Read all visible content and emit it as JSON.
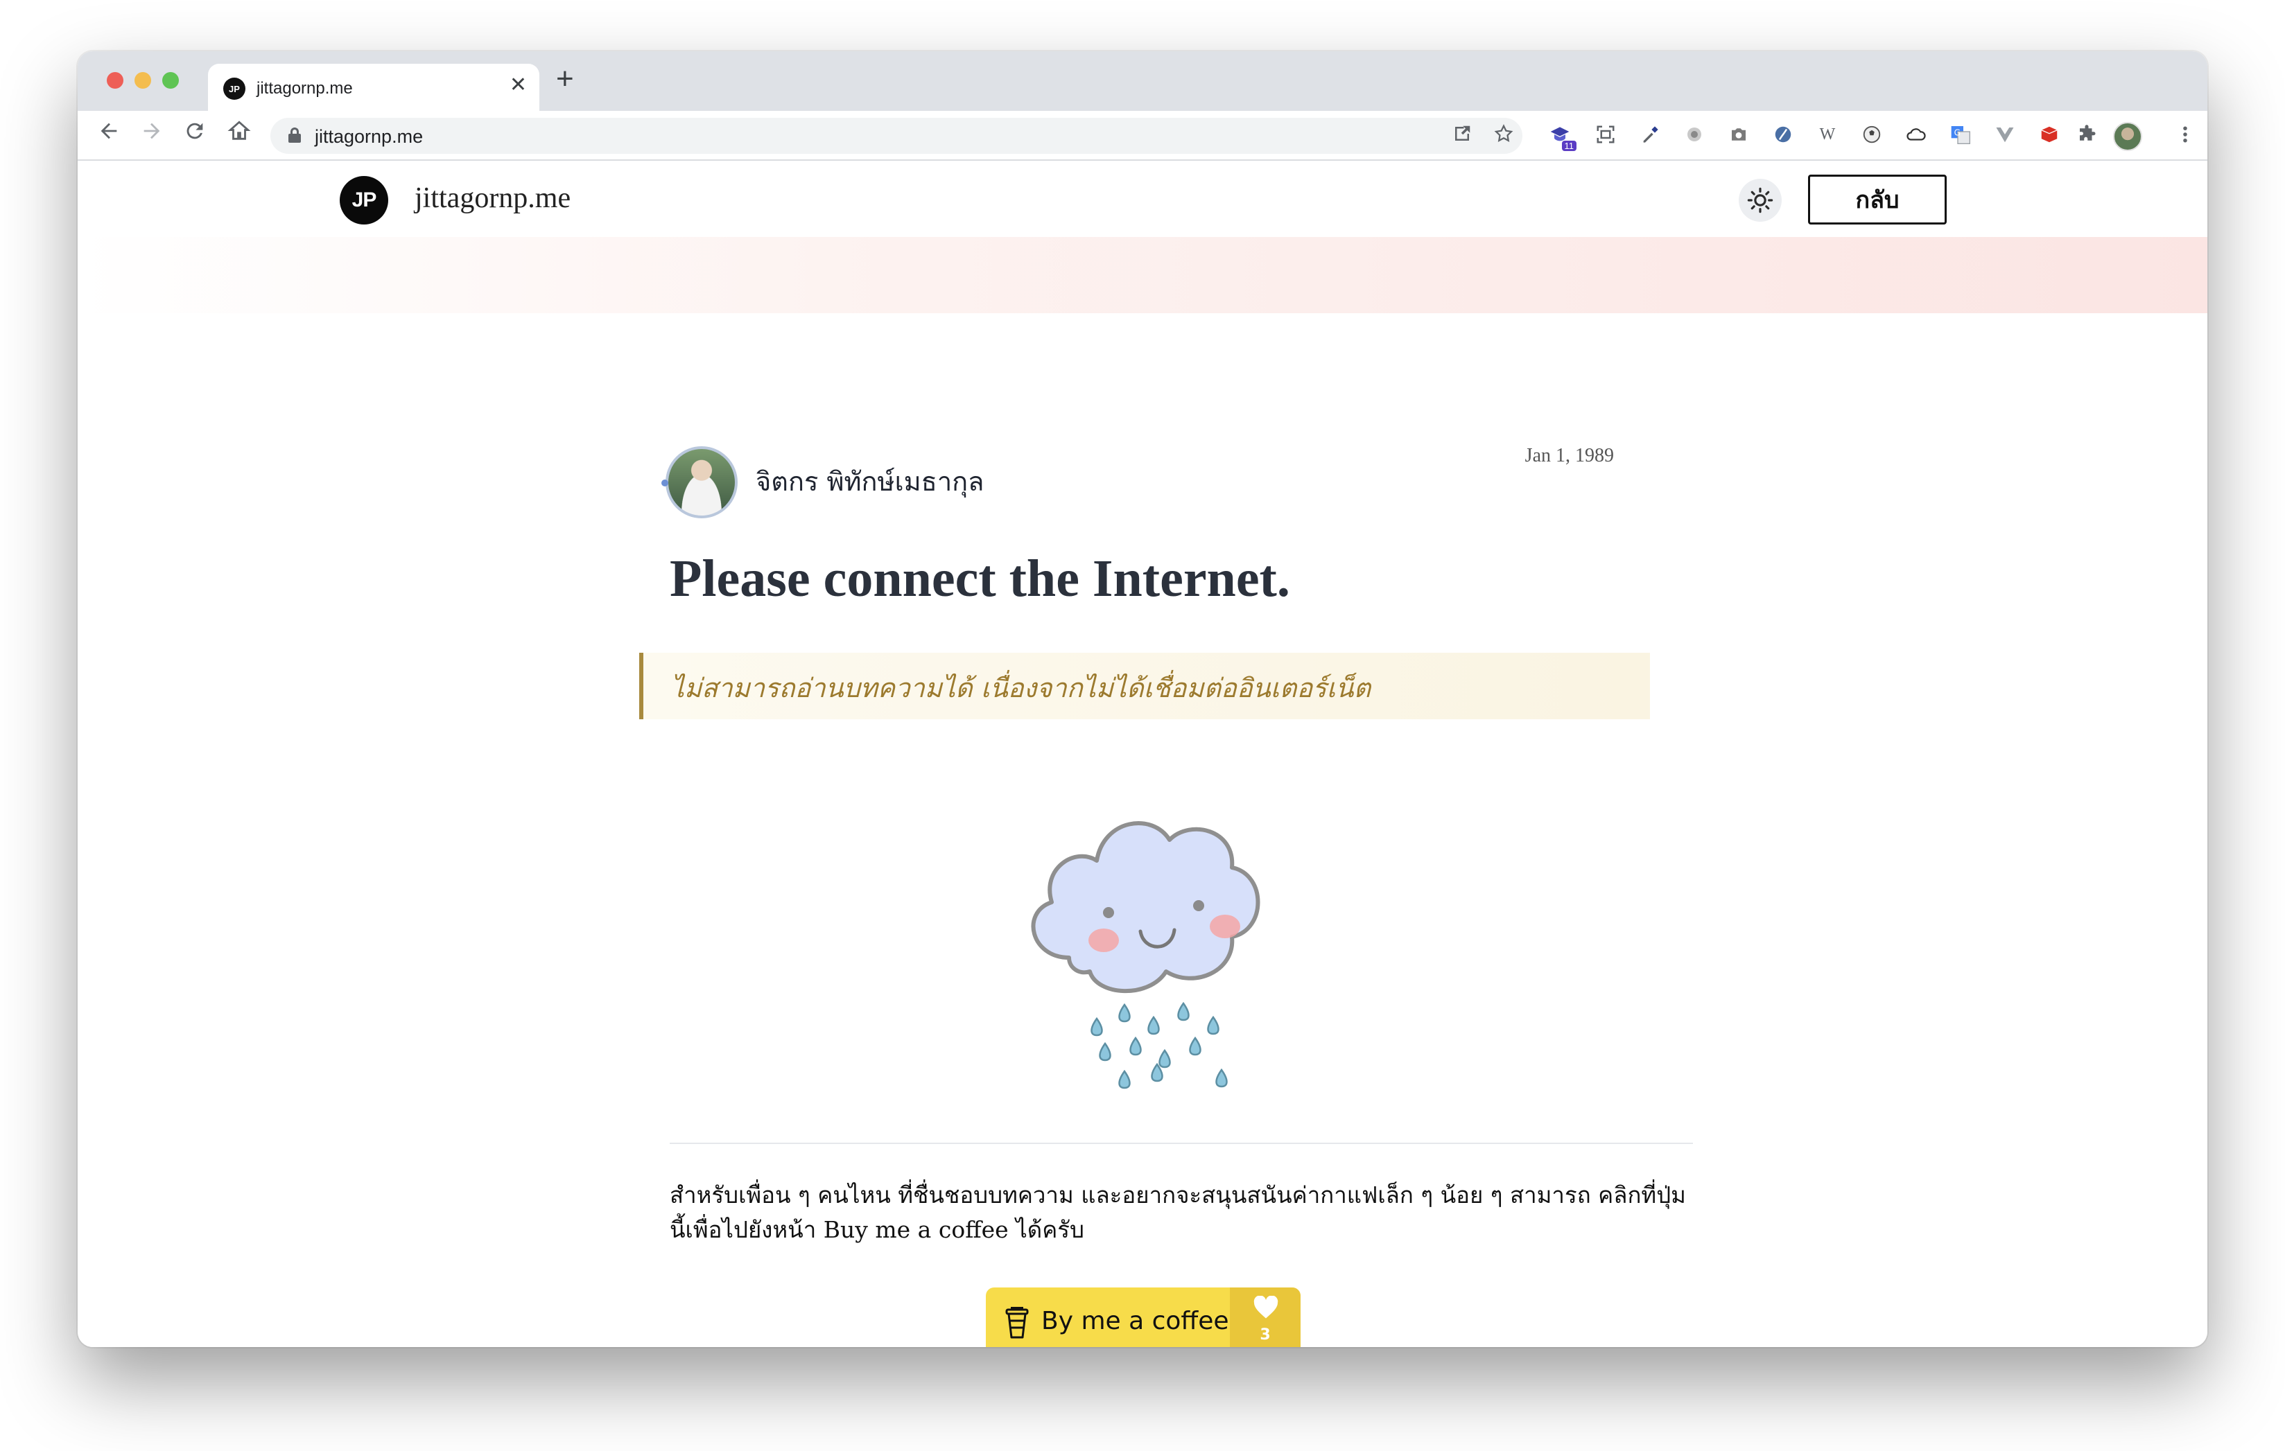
{
  "browser": {
    "tab": {
      "favicon_text": "JP",
      "title": "jittagornp.me",
      "close_glyph": "✕"
    },
    "new_tab_glyph": "+",
    "address": {
      "url": "jittagornp.me"
    },
    "extension_badge": "11"
  },
  "site": {
    "logo_text": "JP",
    "name": "jittagornp.me",
    "back_label": "กลับ",
    "banner_colors": [
      "#ffffff",
      "#fbe5e3"
    ]
  },
  "post": {
    "author": "จิตกร พิทักษ์เมธากุล",
    "date": "Jan 1, 1989",
    "title": "Please connect the Internet.",
    "quote": "ไม่สามารถอ่านบทความได้ เนื่องจากไม่ได้เชื่อมต่ออินเตอร์เน็ต",
    "illustration": "rain-cloud-smiling",
    "support_text": "สำหรับเพื่อน ๆ คนไหน ที่ชื่นชอบบทความ และอยากจะสนุนสนันค่ากาแฟเล็ก ๆ น้อย ๆ สามารถ คลิกที่ปุ่มนี้เพื่อไปยังหน้า Buy me a coffee ได้ครับ"
  },
  "coffee_button": {
    "label": "By me a coffee",
    "count": "3",
    "colors": {
      "main": "#f7dc4a",
      "counter": "#e9c63a"
    }
  }
}
